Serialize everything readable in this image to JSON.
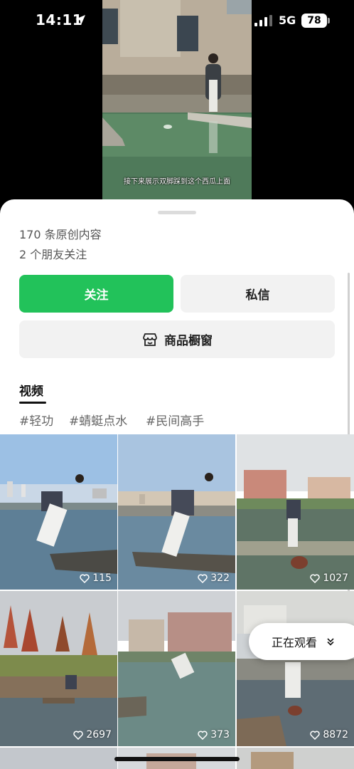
{
  "status_bar": {
    "time": "14:11",
    "network": "5G",
    "battery": "78"
  },
  "video": {
    "caption": "接下来展示双脚踩到这个西瓜上面"
  },
  "profile": {
    "original_count": "170 条原创内容",
    "friends_following": "2 个朋友关注",
    "follow_label": "关注",
    "message_label": "私信",
    "shop_label": "商品橱窗"
  },
  "tabs": {
    "video_label": "视频"
  },
  "hashtags": [
    "#轻功",
    "#蜻蜓点水",
    "#民间高手"
  ],
  "grid": [
    {
      "likes": "115"
    },
    {
      "likes": "322"
    },
    {
      "likes": "1027"
    },
    {
      "likes": "2697"
    },
    {
      "likes": "373"
    },
    {
      "likes": "8872"
    }
  ],
  "watching": {
    "label": "正在观看"
  },
  "colors": {
    "follow_green": "#22c25a",
    "button_gray": "#f2f2f2"
  }
}
